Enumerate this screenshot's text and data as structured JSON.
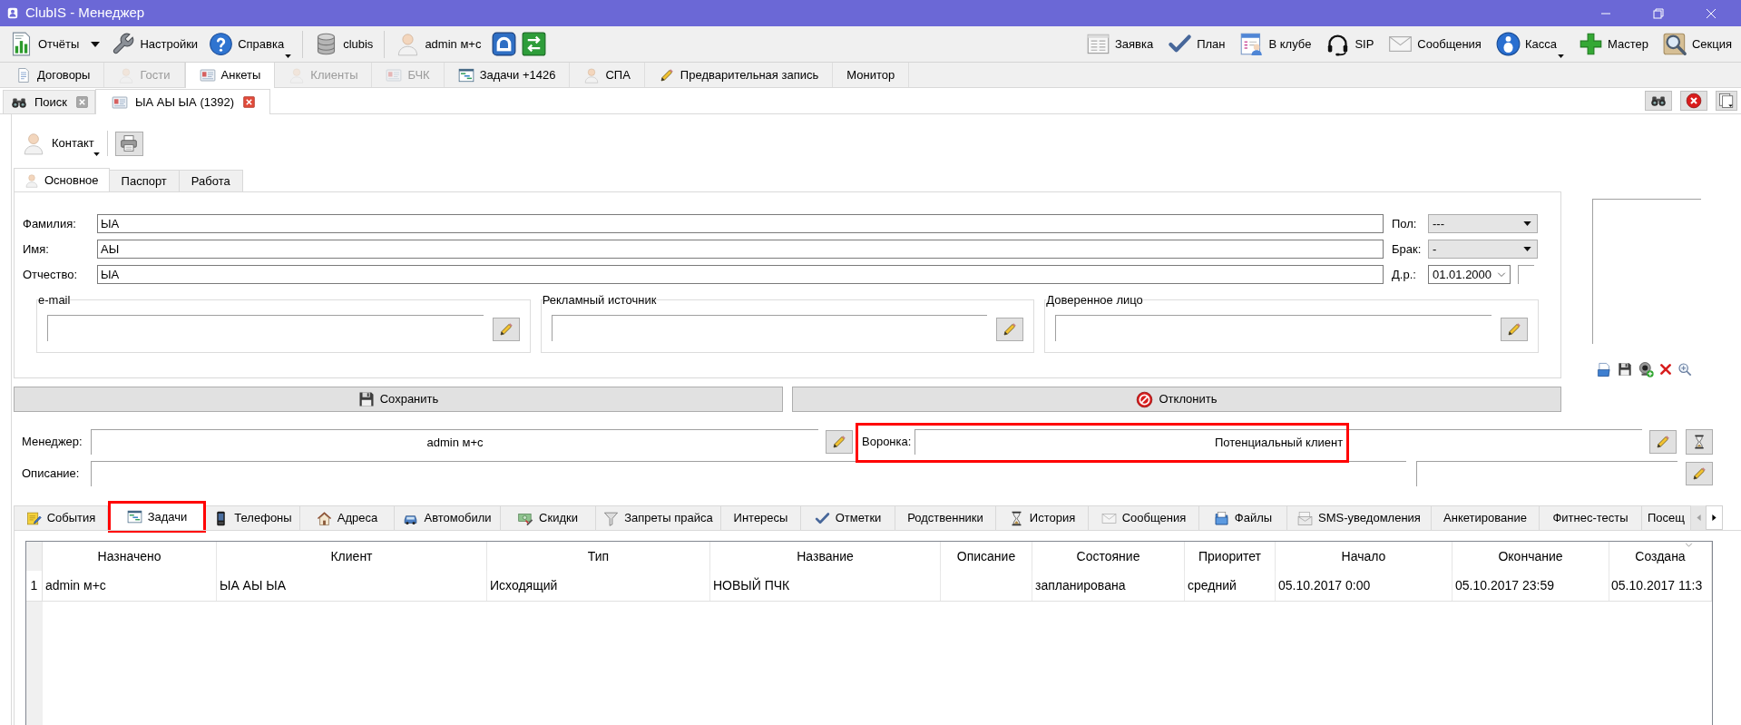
{
  "window": {
    "title": "ClubIS - Менеджер"
  },
  "toolbar": {
    "left": [
      {
        "label": "Отчёты",
        "kind": "split"
      },
      {
        "label": "Настройки",
        "kind": "plain"
      },
      {
        "label": "Справка",
        "kind": "menu"
      },
      {
        "label": "clubis",
        "kind": "plain"
      },
      {
        "label": "admin м+с",
        "kind": "plain"
      }
    ],
    "right": [
      {
        "label": "Заявка",
        "kind": "plain"
      },
      {
        "label": "План",
        "kind": "plain"
      },
      {
        "label": "В клубе",
        "kind": "plain"
      },
      {
        "label": "SIP",
        "kind": "plain"
      },
      {
        "label": "Сообщения",
        "kind": "plain"
      },
      {
        "label": "Касса",
        "kind": "menu"
      },
      {
        "label": "Мастер",
        "kind": "plain"
      },
      {
        "label": "Секция",
        "kind": "plain"
      }
    ]
  },
  "module_tabs": [
    {
      "label": "Договоры",
      "selected": false,
      "disabled": false
    },
    {
      "label": "Гости",
      "selected": false,
      "disabled": true
    },
    {
      "label": "Анкеты",
      "selected": true,
      "disabled": false
    },
    {
      "label": "Клиенты",
      "selected": false,
      "disabled": true
    },
    {
      "label": "БЧК",
      "selected": false,
      "disabled": true
    },
    {
      "label": "Задачи +1426",
      "selected": false,
      "disabled": false
    },
    {
      "label": "СПА",
      "selected": false,
      "disabled": false
    },
    {
      "label": "Предварительная запись",
      "selected": false,
      "disabled": false
    },
    {
      "label": "Монитор",
      "selected": false,
      "disabled": false
    }
  ],
  "document_tabs": [
    {
      "label": "Поиск",
      "selected": false
    },
    {
      "label": "ЫА АЫ ЫА (1392)",
      "selected": true
    }
  ],
  "contact_menu": {
    "label": "Контакт"
  },
  "form_tabs": [
    {
      "label": "Основное",
      "selected": true
    },
    {
      "label": "Паспорт",
      "selected": false
    },
    {
      "label": "Работа",
      "selected": false
    }
  ],
  "name_fields": [
    {
      "label": "Фамилия:",
      "value": "ЫА"
    },
    {
      "label": "Имя:",
      "value": "АЫ"
    },
    {
      "label": "Отчество:",
      "value": "ЫА"
    }
  ],
  "side_fields": [
    {
      "label": "Пол:",
      "value": "---",
      "kind": "select"
    },
    {
      "label": "Брак:",
      "value": "-",
      "kind": "select"
    },
    {
      "label": "Д.р.:",
      "value": "01.01.2000",
      "kind": "date"
    }
  ],
  "groups": [
    {
      "title": "e-mail"
    },
    {
      "title": "Рекламный источник"
    },
    {
      "title": "Доверенное лицо"
    }
  ],
  "actions": [
    {
      "label": "Сохранить",
      "kind": "save"
    },
    {
      "label": "Отклонить",
      "kind": "reject"
    }
  ],
  "manager": {
    "label": "Менеджер:",
    "value": "admin м+с"
  },
  "funnel": {
    "label": "Воронка:",
    "value": "Потенциальный клиент",
    "highlighted": true
  },
  "description": {
    "label": "Описание:"
  },
  "detail_tabs": [
    {
      "label": "События",
      "selected": false,
      "highlighted": false
    },
    {
      "label": "Задачи",
      "selected": true,
      "highlighted": true
    },
    {
      "label": "Телефоны",
      "selected": false,
      "highlighted": false
    },
    {
      "label": "Адреса",
      "selected": false,
      "highlighted": false
    },
    {
      "label": "Автомобили",
      "selected": false,
      "highlighted": false
    },
    {
      "label": "Скидки",
      "selected": false,
      "highlighted": false
    },
    {
      "label": "Запреты прайса",
      "selected": false,
      "highlighted": false
    },
    {
      "label": "Интересы",
      "selected": false,
      "highlighted": false
    },
    {
      "label": "Отметки",
      "selected": false,
      "highlighted": false
    },
    {
      "label": "Родственники",
      "selected": false,
      "highlighted": false
    },
    {
      "label": "История",
      "selected": false,
      "highlighted": false
    },
    {
      "label": "Сообщения",
      "selected": false,
      "highlighted": false
    },
    {
      "label": "Файлы",
      "selected": false,
      "highlighted": false
    },
    {
      "label": "SMS-уведомления",
      "selected": false,
      "highlighted": false
    },
    {
      "label": "Анкетирование",
      "selected": false,
      "highlighted": false
    },
    {
      "label": "Фитнес-тесты",
      "selected": false,
      "highlighted": false
    },
    {
      "label": "Посещ",
      "selected": false,
      "highlighted": false
    }
  ],
  "table": {
    "columns": [
      "Назначено",
      "Клиент",
      "Тип",
      "Название",
      "Описание",
      "Состояние",
      "Приоритет",
      "Начало",
      "Окончание",
      "Создана"
    ],
    "rows": [
      {
        "number": "1",
        "cells": [
          "admin м+с",
          "ЫА АЫ ЫА",
          "Исходящий",
          "НОВЫЙ ПЧК",
          null,
          "запланирована",
          "средний",
          "05.10.2017 0:00",
          "05.10.2017 23:59",
          "05.10.2017 11:3"
        ]
      }
    ]
  }
}
